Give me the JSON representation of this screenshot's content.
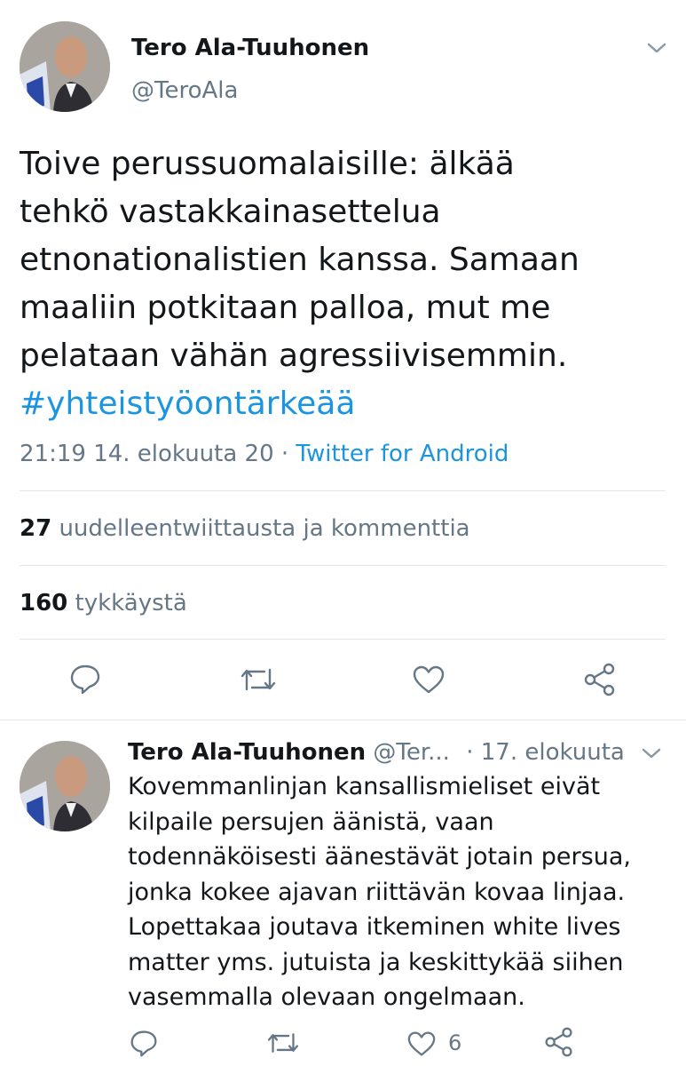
{
  "main_tweet": {
    "author_name": "Tero Ala-Tuuhonen",
    "author_handle": "@TeroAla",
    "text_lines": [
      "Toive perussuomalaisille: älkää",
      "tehkö vastakkainasettelua",
      "etnonationalistien kanssa. Samaan",
      "maaliin potkitaan palloa, mut me",
      "pelataan vähän agressiivisemmin."
    ],
    "hashtag": "#yhteistyöontärkeää",
    "timestamp": "21:19 14. elokuuta 20",
    "separator": "·",
    "source": "Twitter for Android",
    "retweets_count": "27",
    "retweets_label": "uudelleentwiittausta ja kommenttia",
    "likes_count": "160",
    "likes_label": "tykkäystä",
    "actions": [
      "reply-icon",
      "retweet-icon",
      "like-icon",
      "share-icon"
    ]
  },
  "reply_tweet": {
    "author_name": "Tero Ala-Tuuhonen",
    "author_handle": "@Ter...",
    "date": "· 17. elokuuta",
    "text_lines": [
      "Kovemmanlinjan kansallismieliset eivät",
      "kilpaile persujen äänistä, vaan",
      "todennäköisesti äänestävät jotain persua,",
      "jonka kokee ajavan riittävän kovaa linjaa.",
      "Lopettakaa joutava itkeminen white lives",
      "matter yms. jutuista ja keskittykää siihen",
      "vasemmalla olevaan ongelmaan."
    ],
    "like_count": "6",
    "actions": [
      "reply-icon",
      "retweet-icon",
      "like-icon",
      "share-icon"
    ]
  },
  "colors": {
    "text": "#14171a",
    "muted": "#657786",
    "link": "#1b95e0",
    "divider": "#e1e8ed"
  }
}
